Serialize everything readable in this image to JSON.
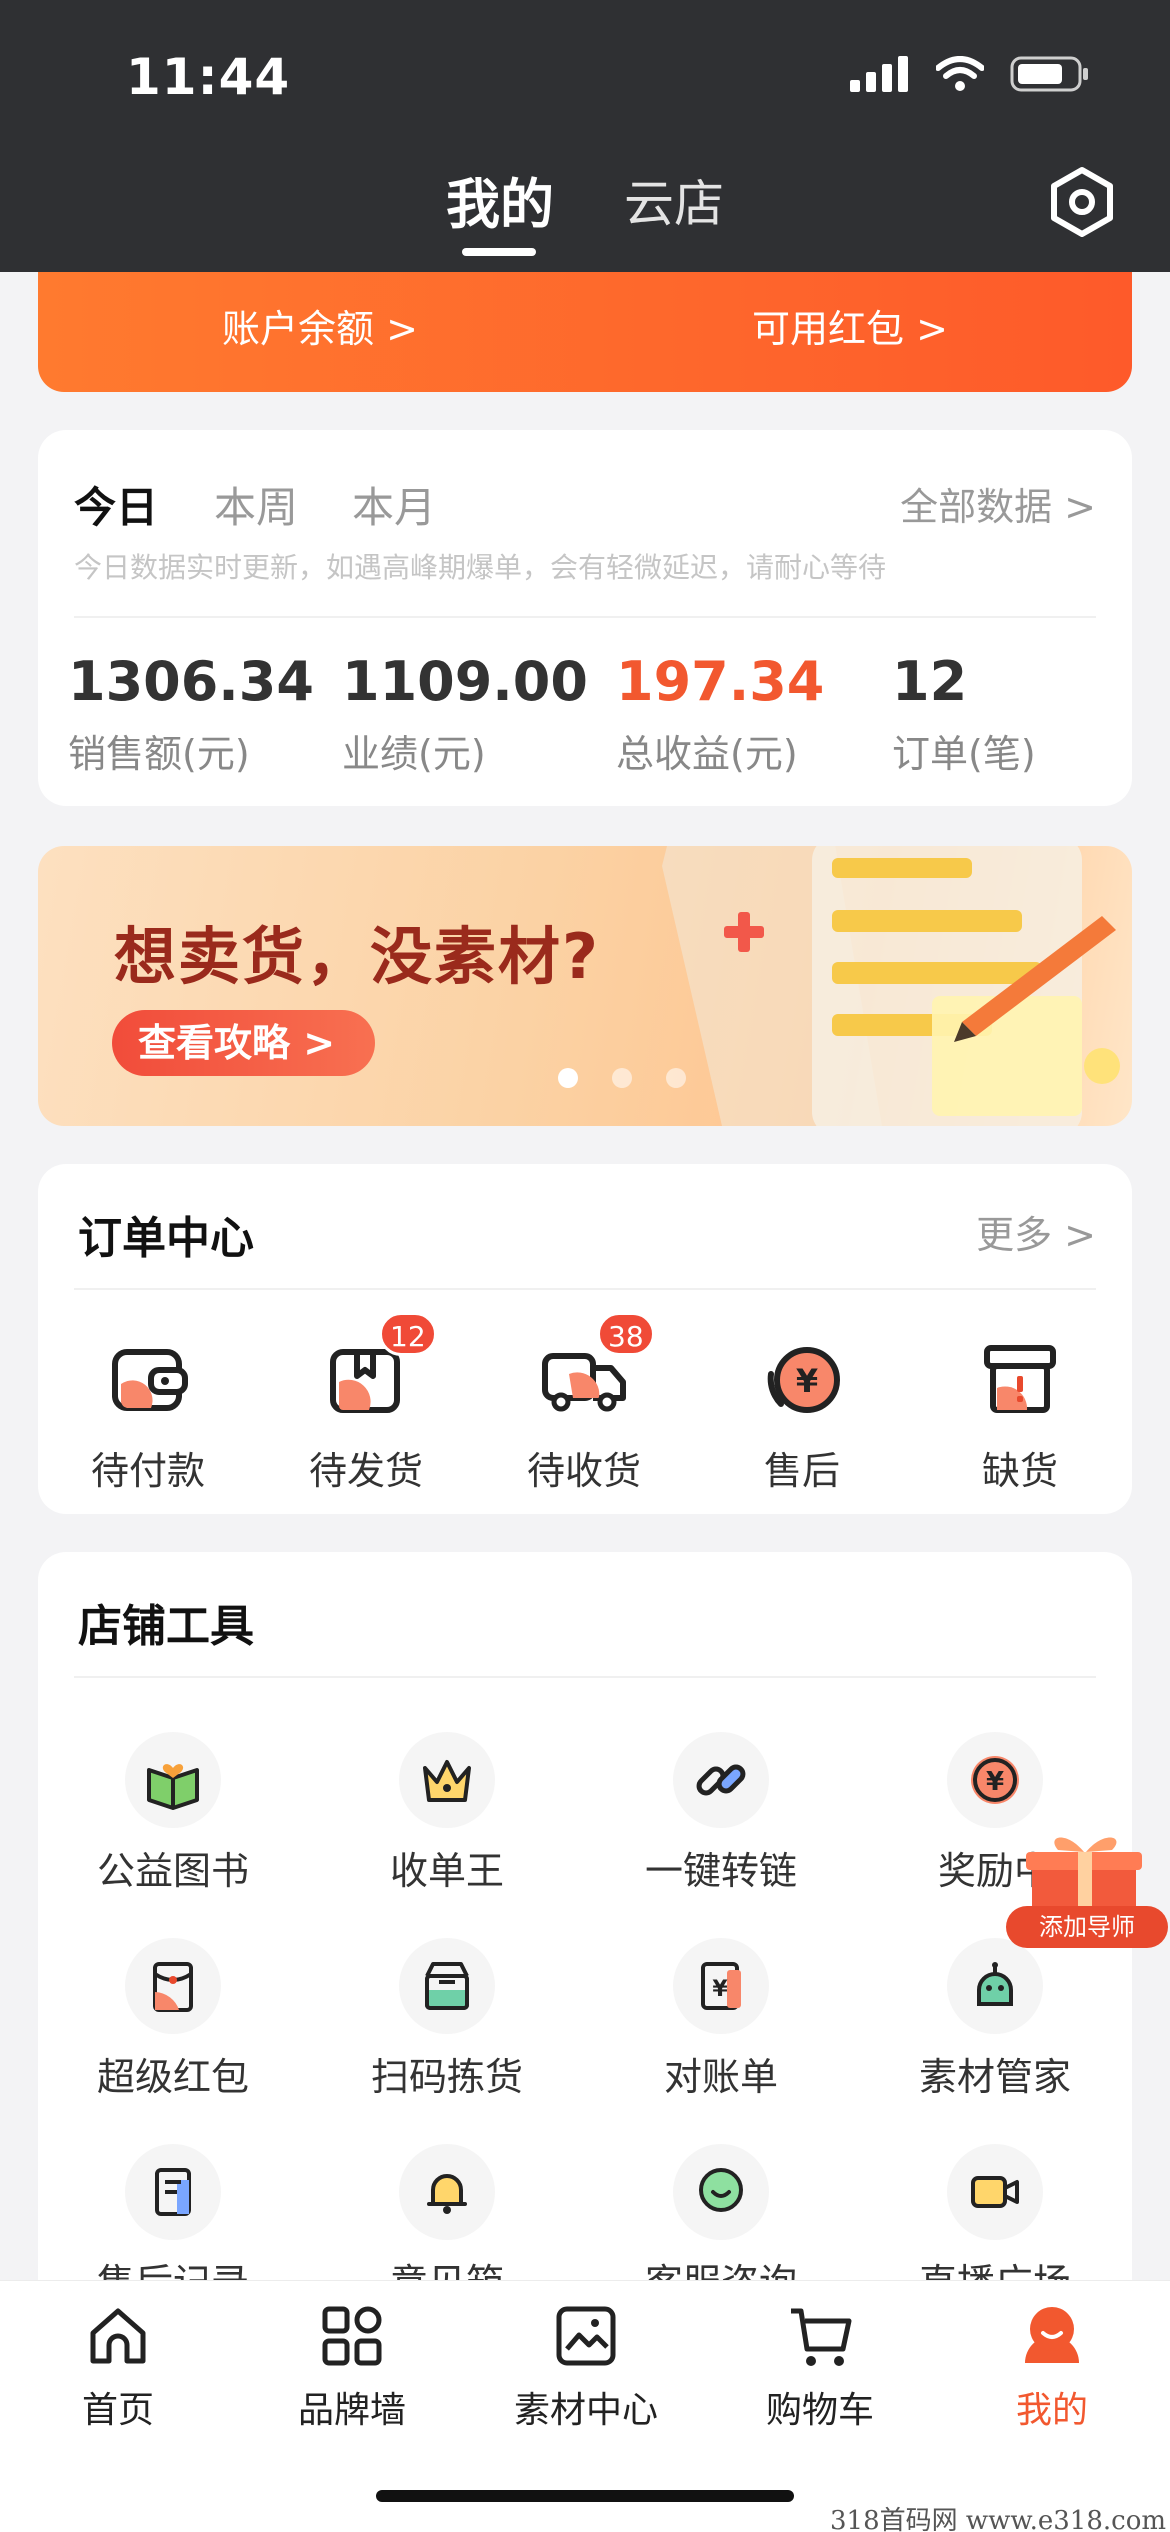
{
  "status_bar": {
    "time": "11:44"
  },
  "header": {
    "tab_active": "我的",
    "tab_inactive": "云店"
  },
  "balance": {
    "account_label": "账户余额 >",
    "redpacket_label": "可用红包 >"
  },
  "stats": {
    "tabs": [
      "今日",
      "本周",
      "本月"
    ],
    "all_data": "全部数据 >",
    "note": "今日数据实时更新，如遇高峰期爆单，会有轻微延迟，请耐心等待",
    "items": [
      {
        "value": "1306.34",
        "label": "销售额(元)"
      },
      {
        "value": "1109.00",
        "label": "业绩(元)"
      },
      {
        "value": "197.34",
        "label": "总收益(元)"
      },
      {
        "value": "12",
        "label": "订单(笔)"
      }
    ]
  },
  "banner": {
    "title": "想卖货，没素材?",
    "button": "查看攻略 >",
    "active_dot": 0
  },
  "orders": {
    "title": "订单中心",
    "more": "更多 >",
    "items": [
      {
        "label": "待付款",
        "icon": "wallet-icon",
        "badge": ""
      },
      {
        "label": "待发货",
        "icon": "package-icon",
        "badge": "12"
      },
      {
        "label": "待收货",
        "icon": "truck-icon",
        "badge": "38"
      },
      {
        "label": "售后",
        "icon": "yuan-refund-icon",
        "badge": ""
      },
      {
        "label": "缺货",
        "icon": "box-alert-icon",
        "badge": ""
      }
    ]
  },
  "tools": {
    "title": "店铺工具",
    "items": [
      {
        "label": "公益图书",
        "icon": "book-heart-icon"
      },
      {
        "label": "收单王",
        "icon": "crown-icon"
      },
      {
        "label": "一键转链",
        "icon": "link-icon"
      },
      {
        "label": "奖励中",
        "icon": "yuan-coin-icon"
      },
      {
        "label": "超级红包",
        "icon": "red-envelope-icon"
      },
      {
        "label": "扫码拣货",
        "icon": "scan-box-icon"
      },
      {
        "label": "对账单",
        "icon": "bill-icon"
      },
      {
        "label": "素材管家",
        "icon": "robot-icon"
      },
      {
        "label": "售后记录",
        "icon": "record-icon"
      },
      {
        "label": "意见箱",
        "icon": "bell-icon"
      },
      {
        "label": "客服咨询",
        "icon": "chat-icon"
      },
      {
        "label": "直播广场",
        "icon": "camera-icon"
      }
    ],
    "float_label": "添加导师"
  },
  "tabbar": {
    "items": [
      {
        "label": "首页",
        "icon": "home-icon"
      },
      {
        "label": "品牌墙",
        "icon": "grid-icon"
      },
      {
        "label": "素材中心",
        "icon": "image-icon"
      },
      {
        "label": "购物车",
        "icon": "cart-icon"
      },
      {
        "label": "我的",
        "icon": "profile-icon"
      }
    ],
    "active_index": 4
  },
  "watermark": "318首码网  www.e318.com",
  "colors": {
    "accent": "#f2582f",
    "header_bg": "#2f3033"
  }
}
